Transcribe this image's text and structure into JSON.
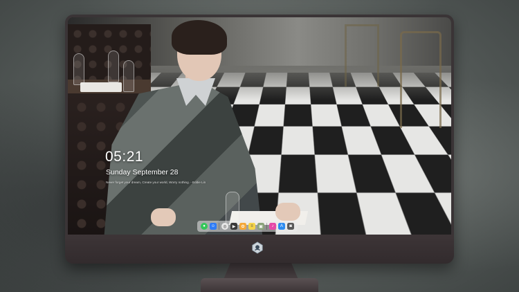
{
  "lock_screen": {
    "time": "05:21",
    "date": "Sunday September  28",
    "quote": "Never forget your dream, Create your world, Worry nothing. - Eddie Lin"
  },
  "dock": {
    "items": [
      {
        "name": "messages-icon",
        "color": "#34c759"
      },
      {
        "name": "finder-icon",
        "color": "#2f7cf6"
      },
      {
        "name": "safari-icon",
        "color": "#e8e8e8"
      },
      {
        "name": "video-icon",
        "color": "#3a3a3a"
      },
      {
        "name": "photos-icon",
        "color": "#f4a83a"
      },
      {
        "name": "notes-icon",
        "color": "#f5d54a"
      },
      {
        "name": "contacts-icon",
        "color": "#8aa37a"
      },
      {
        "name": "itunes-icon",
        "color": "#e54aa8"
      },
      {
        "name": "app-store-icon",
        "color": "#2d8cf0"
      },
      {
        "name": "camera-icon",
        "color": "#5a5a5a"
      }
    ]
  },
  "monitor": {
    "logo": "stand-logo-icon"
  }
}
